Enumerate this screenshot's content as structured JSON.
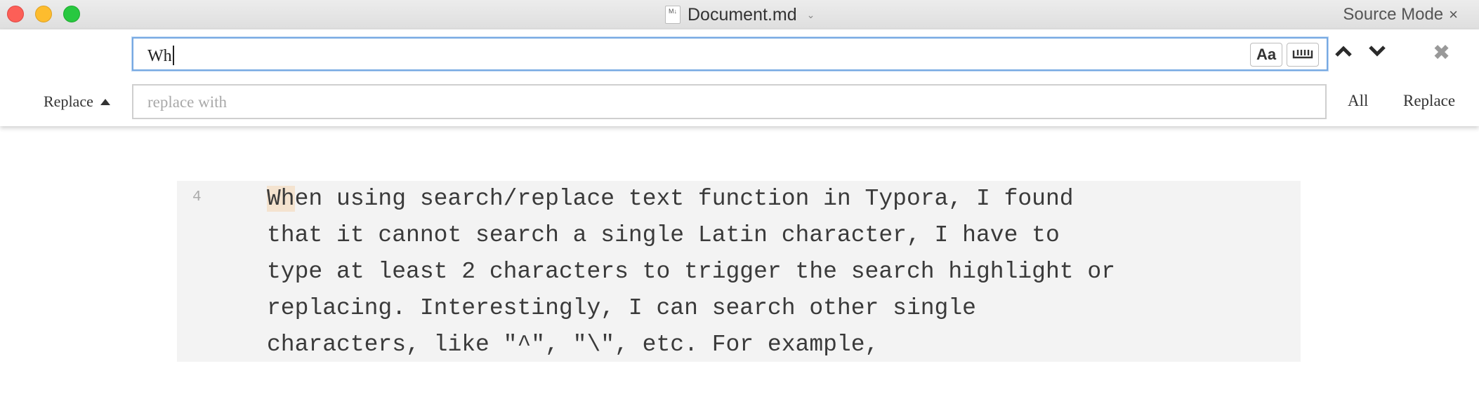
{
  "window": {
    "title": "Document.md",
    "file_icon_label": "M↓",
    "mode_label": "Source Mode",
    "mode_close": "×"
  },
  "search": {
    "find_value": "Wh",
    "case_option_label": "Aa",
    "case_option_icon": "match-case-icon",
    "word_option_icon": "whole-word-icon",
    "prev_icon": "chevron-up-icon",
    "next_icon": "chevron-down-icon",
    "close_icon": "close-icon",
    "close_glyph": "✖",
    "replace_toggle_label": "Replace",
    "replace_placeholder": "replace with",
    "replace_all_label": "All",
    "replace_label": "Replace"
  },
  "editor": {
    "line_number": "4",
    "match_text": "Wh",
    "first_line_rest": "en using search/replace text function in Typora, I found",
    "lines": [
      "that it cannot search a single Latin character, I have to",
      "type at least 2 characters to trigger the search highlight or",
      "replacing. Interestingly, I can search other single",
      "characters, like \"^\", \"\\\", etc. For example,"
    ]
  },
  "colors": {
    "match_highlight": "#f4e3cf",
    "focus_border": "#77a9e2",
    "code_background": "#f3f3f3"
  }
}
